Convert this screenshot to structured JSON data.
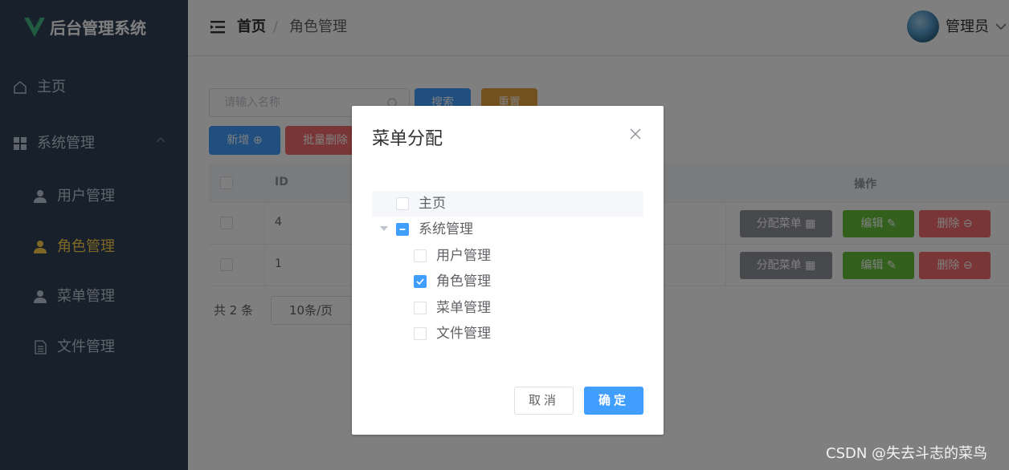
{
  "app": {
    "title": "后台管理系统"
  },
  "sidebar": {
    "items": [
      {
        "label": "主页",
        "icon": "home-icon"
      },
      {
        "label": "系统管理",
        "icon": "grid-icon"
      },
      {
        "label": "用户管理",
        "icon": "user-icon"
      },
      {
        "label": "角色管理",
        "icon": "user-icon"
      },
      {
        "label": "菜单管理",
        "icon": "user-icon"
      },
      {
        "label": "文件管理",
        "icon": "document-icon"
      }
    ],
    "active_color": "#ffd04b",
    "bg_color": "#304156"
  },
  "header": {
    "breadcrumb_home": "首页",
    "breadcrumb_sep": "/",
    "breadcrumb_current": "角色管理",
    "user_name": "管理员"
  },
  "toolbar": {
    "search_placeholder": "请输入名称",
    "search_label": "搜索",
    "reset_label": "重置",
    "add_label": "新增 ⊕",
    "batch_delete_label": "批量删除"
  },
  "table": {
    "headers": {
      "id": "ID",
      "actions": "操作"
    },
    "rows": [
      {
        "id": "4"
      },
      {
        "id": "1"
      }
    ],
    "row_actions": {
      "assign_menu": "分配菜单",
      "edit": "编辑",
      "delete": "删除"
    }
  },
  "pagination": {
    "total": "共 2 条",
    "page_size": "10条/页"
  },
  "dialog": {
    "title": "菜单分配",
    "tree": [
      {
        "label": "主页",
        "state": "unchecked",
        "level": 0
      },
      {
        "label": "系统管理",
        "state": "indeterminate",
        "level": 0,
        "expanded": true
      },
      {
        "label": "用户管理",
        "state": "unchecked",
        "level": 1
      },
      {
        "label": "角色管理",
        "state": "checked",
        "level": 1
      },
      {
        "label": "菜单管理",
        "state": "unchecked",
        "level": 1
      },
      {
        "label": "文件管理",
        "state": "unchecked",
        "level": 1
      }
    ],
    "cancel_label": "取消",
    "ok_label": "确定"
  },
  "watermark": "CSDN @失去斗志的菜鸟",
  "colors": {
    "primary": "#409eff",
    "warning": "#e6a23c",
    "danger": "#f56c6c",
    "success": "#67c23a",
    "info": "#909399"
  }
}
